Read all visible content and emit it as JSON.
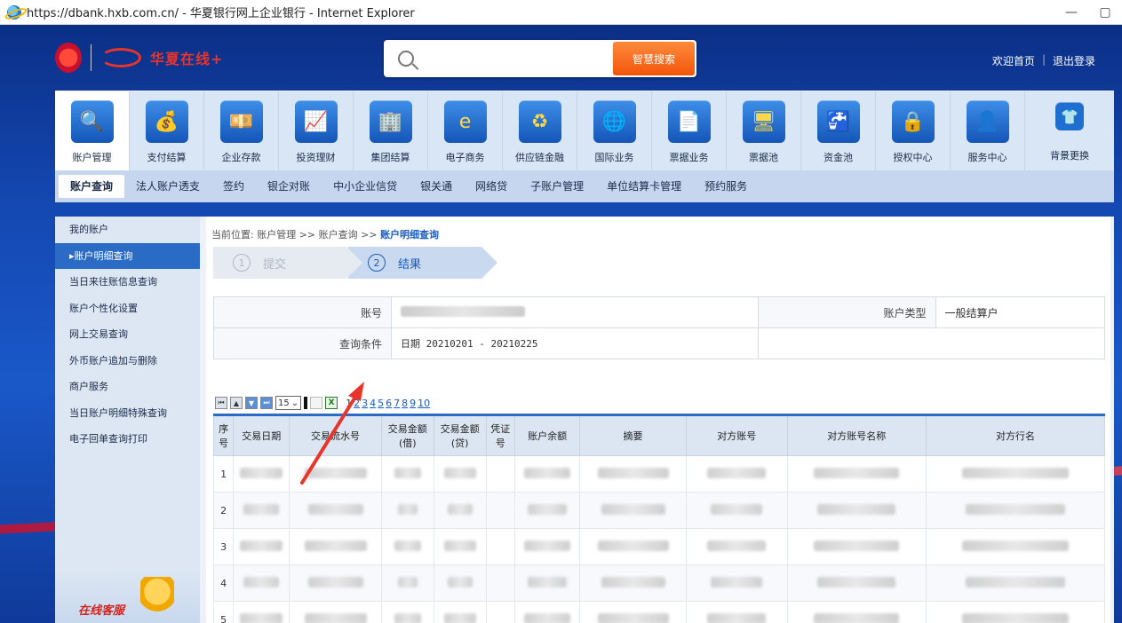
{
  "window": {
    "title": "https://dbank.hxb.com.cn/ - 华夏银行网上企业银行 - Internet Explorer",
    "minimize": "—",
    "restore": "▢"
  },
  "header": {
    "logo_text": "华夏在线+",
    "search_placeholder": "",
    "search_button": "智慧搜索",
    "home_link": "欢迎首页",
    "divider": "|",
    "logout_link": "退出登录"
  },
  "menu": [
    {
      "label": "账户管理",
      "icon": "magnifier-account-icon",
      "glyph": "🔍",
      "active": true
    },
    {
      "label": "支付结算",
      "icon": "coins-icon",
      "glyph": "💰"
    },
    {
      "label": "企业存款",
      "icon": "deposit-icon",
      "glyph": "💴"
    },
    {
      "label": "投资理财",
      "icon": "investment-icon",
      "glyph": "📈"
    },
    {
      "label": "集团结算",
      "icon": "group-settlement-icon",
      "glyph": "🏢"
    },
    {
      "label": "电子商务",
      "icon": "ie-commerce-icon",
      "glyph": "e"
    },
    {
      "label": "供应链金融",
      "icon": "supply-chain-icon",
      "glyph": "♻"
    },
    {
      "label": "国际业务",
      "icon": "globe-icon",
      "glyph": "🌐"
    },
    {
      "label": "票据业务",
      "icon": "bill-icon",
      "glyph": "📄"
    },
    {
      "label": "票据池",
      "icon": "bill-pool-icon",
      "glyph": "🖥"
    },
    {
      "label": "资金池",
      "icon": "faucet-icon",
      "glyph": "🚰"
    },
    {
      "label": "授权中心",
      "icon": "lock-icon",
      "glyph": "🔒"
    },
    {
      "label": "服务中心",
      "icon": "person-icon",
      "glyph": "👤"
    },
    {
      "label": "背景更换",
      "icon": "tshirt-icon",
      "glyph": "👕"
    }
  ],
  "submenu": [
    {
      "label": "账户查询",
      "active": true
    },
    {
      "label": "法人账户透支"
    },
    {
      "label": "签约"
    },
    {
      "label": "银企对账"
    },
    {
      "label": "中小企业信贷"
    },
    {
      "label": "银关通"
    },
    {
      "label": "网络贷"
    },
    {
      "label": "子账户管理"
    },
    {
      "label": "单位结算卡管理"
    },
    {
      "label": "预约服务"
    }
  ],
  "sidebar": {
    "items": [
      {
        "label": "我的账户"
      },
      {
        "label": "账户明细查询",
        "active": true
      },
      {
        "label": "当日来往账信息查询"
      },
      {
        "label": "账户个性化设置"
      },
      {
        "label": "网上交易查询"
      },
      {
        "label": "外币账户追加与删除"
      },
      {
        "label": "商户服务"
      },
      {
        "label": "当日账户明细特殊查询"
      },
      {
        "label": "电子回单查询打印"
      }
    ],
    "online_service": "在线客服"
  },
  "breadcrumb": {
    "prefix": "当前位置: 账户管理 >> 账户查询 >> ",
    "current": "账户明细查询"
  },
  "steps": [
    {
      "num": "1",
      "label": "提交"
    },
    {
      "num": "2",
      "label": "结果"
    }
  ],
  "info": {
    "account_label": "账号",
    "account_type_label": "账户类型",
    "account_type_value": "一般结算户",
    "query_label": "查询条件",
    "query_value": "日期  20210201  -  20210225"
  },
  "pager": {
    "page_size": "15",
    "pages": [
      "1",
      "2",
      "3",
      "4",
      "5",
      "6",
      "7",
      "8",
      "9",
      "10"
    ],
    "current_page": "1",
    "excel_icon_text": "X"
  },
  "table": {
    "headers": [
      "序号",
      "交易日期",
      "交易流水号",
      "交易金额(借)",
      "交易金额(贷)",
      "凭证号",
      "账户余额",
      "摘要",
      "对方账号",
      "对方账号名称",
      "对方行名"
    ],
    "rows": [
      "1",
      "2",
      "3",
      "4",
      "5"
    ]
  },
  "colors": {
    "accent": "#2a6bc6",
    "search_button": "#f2560b",
    "annotation_arrow": "#e8342a"
  }
}
